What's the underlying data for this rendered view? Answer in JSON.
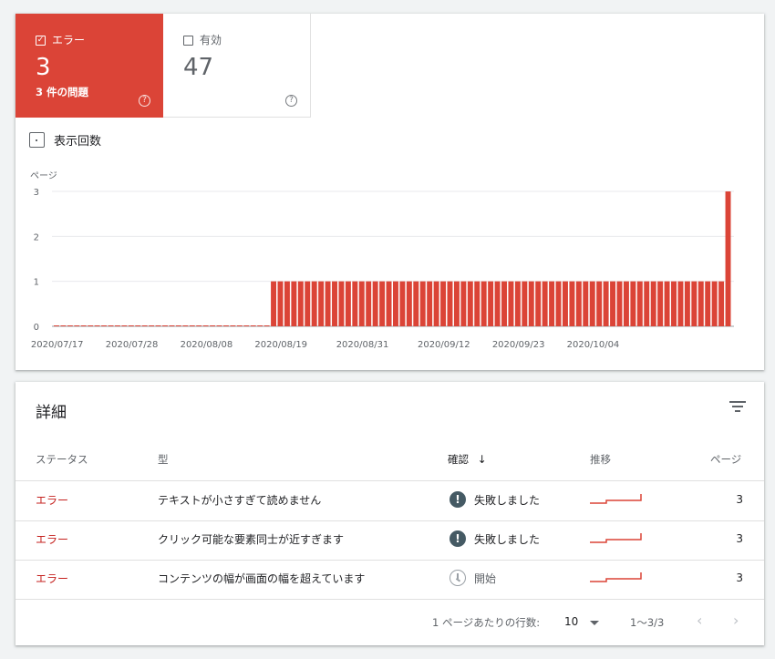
{
  "summary": {
    "error": {
      "label": "エラー",
      "count": "3",
      "subtitle": "3 件の問題",
      "checked": true
    },
    "valid": {
      "label": "有効",
      "count": "47",
      "checked": false
    }
  },
  "impressions_label": "表示回数",
  "chart_data": {
    "type": "bar",
    "ylabel": "ページ",
    "ylim": [
      0,
      3
    ],
    "yticks": [
      "0",
      "1",
      "2",
      "3"
    ],
    "xtick_labels": [
      "2020/07/17",
      "2020/07/28",
      "2020/08/08",
      "2020/08/19",
      "2020/08/31",
      "2020/09/12",
      "2020/09/23",
      "2020/10/04"
    ],
    "color": "#db4437",
    "series": [
      {
        "start_date": "2020/07/17",
        "days_per_bar": 1,
        "values": [
          0,
          0,
          0,
          0,
          0,
          0,
          0,
          0,
          0,
          0,
          0,
          0,
          0,
          0,
          0,
          0,
          0,
          0,
          0,
          0,
          0,
          0,
          0,
          0,
          0,
          0,
          0,
          0,
          0,
          0,
          0,
          0,
          1,
          1,
          1,
          1,
          1,
          1,
          1,
          1,
          1,
          1,
          1,
          1,
          1,
          1,
          1,
          1,
          1,
          1,
          1,
          1,
          1,
          1,
          1,
          1,
          1,
          1,
          1,
          1,
          1,
          1,
          1,
          1,
          1,
          1,
          1,
          1,
          1,
          1,
          1,
          1,
          1,
          1,
          1,
          1,
          1,
          1,
          1,
          1,
          1,
          1,
          1,
          1,
          1,
          1,
          1,
          1,
          1,
          1,
          1,
          1,
          1,
          1,
          1,
          1,
          1,
          1,
          1,
          3
        ]
      }
    ]
  },
  "details": {
    "title": "詳細",
    "columns": {
      "status": "ステータス",
      "type": "型",
      "validation": "確認",
      "trend": "推移",
      "pages": "ページ"
    },
    "rows": [
      {
        "status": "エラー",
        "type": "テキストが小さすぎて読めません",
        "validation": "失敗しました",
        "validation_icon": "failed-icon",
        "pages": "3"
      },
      {
        "status": "エラー",
        "type": "クリック可能な要素同士が近すぎます",
        "validation": "失敗しました",
        "validation_icon": "failed-icon",
        "pages": "3"
      },
      {
        "status": "エラー",
        "type": "コンテンツの幅が画面の幅を超えています",
        "validation": "開始",
        "validation_icon": "clock-icon",
        "pages": "3"
      }
    ],
    "footer": {
      "rows_per_page_label": "1 ページあたりの行数:",
      "rows_per_page": "10",
      "range": "1〜3/3"
    }
  },
  "colors": {
    "error": "#db4437",
    "error_text": "#c5221f",
    "grid": "#e8eaed"
  }
}
